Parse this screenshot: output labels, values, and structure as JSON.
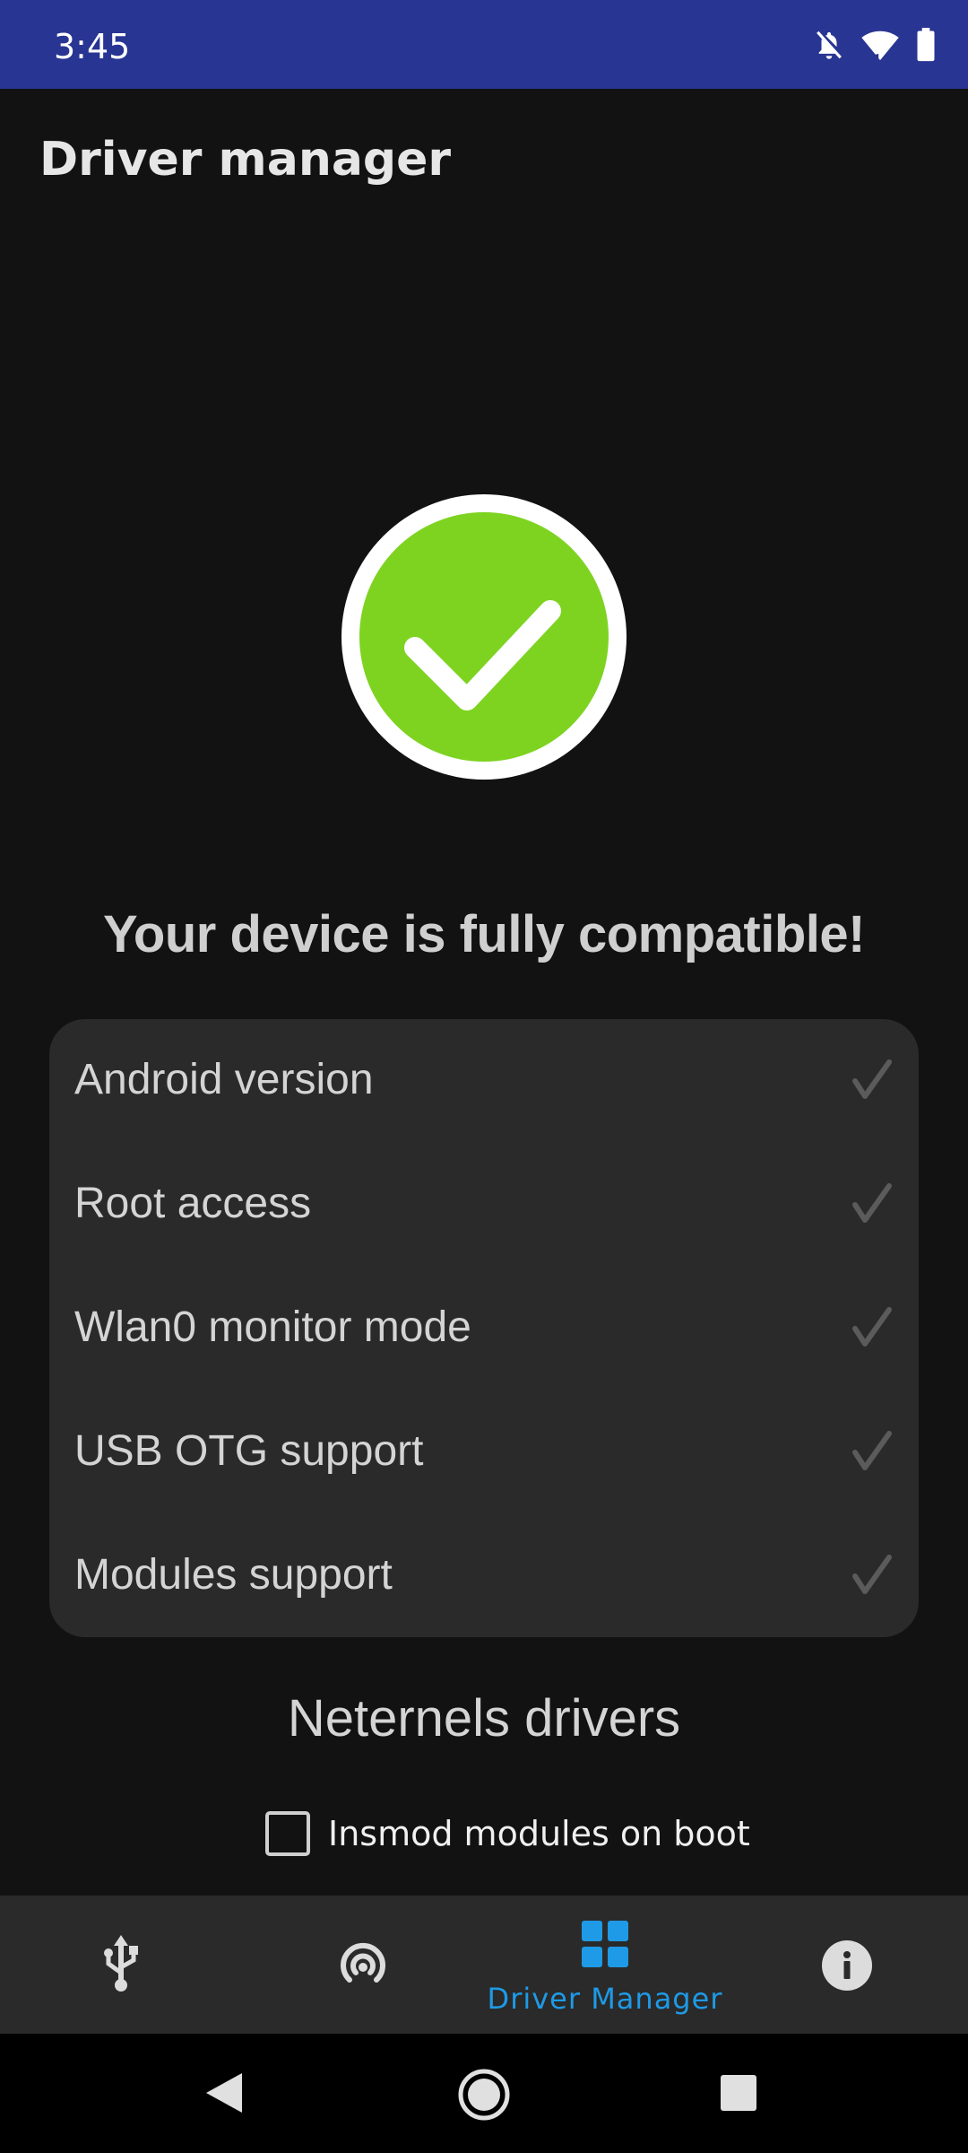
{
  "status_bar": {
    "time": "3:45",
    "icons": [
      "notifications-off-icon",
      "wifi-icon",
      "battery-icon"
    ],
    "background": "#283593"
  },
  "app": {
    "title": "Driver manager"
  },
  "compatibility": {
    "status_icon": "check-circle-icon",
    "status_color": "#7ed321",
    "message": "Your device is fully compatible!",
    "checks": [
      {
        "label": "Android version",
        "passed": true,
        "icon": "checkmark-icon"
      },
      {
        "label": "Root access",
        "passed": true,
        "icon": "checkmark-icon"
      },
      {
        "label": "Wlan0 monitor mode",
        "passed": true,
        "icon": "checkmark-icon"
      },
      {
        "label": "USB OTG support",
        "passed": true,
        "icon": "checkmark-icon"
      },
      {
        "label": "Modules support",
        "passed": true,
        "icon": "checkmark-icon"
      }
    ]
  },
  "drivers": {
    "section_title": "Neternels drivers",
    "insmod_on_boot": {
      "label": "Insmod modules on boot",
      "checked": false
    }
  },
  "bottom_nav": {
    "active_color": "#1e9ae6",
    "items": [
      {
        "icon": "usb-icon",
        "label": "",
        "active": false
      },
      {
        "icon": "wireless-signal-icon",
        "label": "",
        "active": false
      },
      {
        "icon": "grid-icon",
        "label": "Driver Manager",
        "active": true
      },
      {
        "icon": "info-icon",
        "label": "",
        "active": false
      }
    ]
  },
  "system_nav": {
    "buttons": [
      "back-icon",
      "home-icon",
      "recents-icon"
    ]
  }
}
